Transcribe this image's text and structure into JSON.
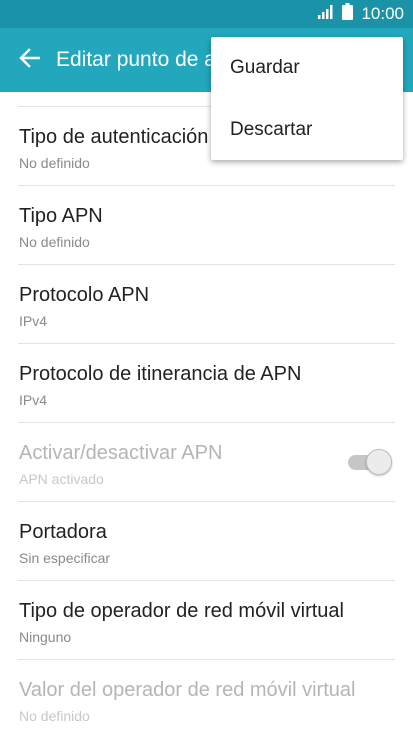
{
  "status_bar": {
    "time": "10:00",
    "signal_icon": "signal-bars-icon",
    "battery_icon": "battery-icon"
  },
  "app_bar": {
    "title": "Editar punto de acceso",
    "back_icon": "arrow-left-icon",
    "color": "#22a7bd"
  },
  "menu": {
    "items": [
      {
        "label": "Guardar"
      },
      {
        "label": "Descartar"
      }
    ]
  },
  "settings": [
    {
      "title": "Tipo de autenticación",
      "value": "No definido"
    },
    {
      "title": "Tipo APN",
      "value": "No definido"
    },
    {
      "title": "Protocolo APN",
      "value": "IPv4"
    },
    {
      "title": "Protocolo de itinerancia de APN",
      "value": "IPv4"
    },
    {
      "title": "Activar/desactivar APN",
      "value": "APN activado",
      "toggle_on": true,
      "disabled": true
    },
    {
      "title": "Portadora",
      "value": "Sin especificar"
    },
    {
      "title": "Tipo de operador de red móvil virtual",
      "value": "Ninguno"
    },
    {
      "title": "Valor del operador de red móvil virtual",
      "value": "No definido",
      "disabled": true
    }
  ]
}
